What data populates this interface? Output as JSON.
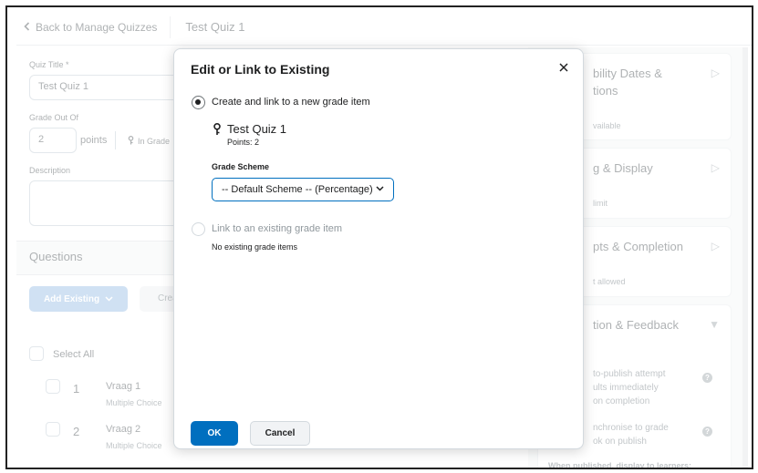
{
  "topbar": {
    "back_label": "Back to Manage Quizzes",
    "title": "Test Quiz 1"
  },
  "form": {
    "quiz_title_label": "Quiz Title *",
    "quiz_title_value": "Test Quiz 1",
    "grade_out_of_label": "Grade Out Of",
    "grade_out_of_value": "2",
    "points_label": "points",
    "in_grade_label": "In Grade",
    "description_label": "Description"
  },
  "questions": {
    "title": "Questions",
    "add_existing_label": "Add Existing",
    "create_label": "Crea",
    "select_all_label": "Select All",
    "items": [
      {
        "number": "1",
        "name": "Vraag 1",
        "type": "Multiple Choice"
      },
      {
        "number": "2",
        "name": "Vraag 2",
        "type": "Multiple Choice"
      }
    ]
  },
  "right_panel": {
    "cards": [
      {
        "title_line1": "bility Dates &",
        "title_line2": "tions",
        "sub": "vailable"
      },
      {
        "title_line1": "g & Display",
        "sub": "limit"
      },
      {
        "title_line1": "pts & Completion",
        "sub": "t allowed"
      },
      {
        "title_line1": "tion & Feedback",
        "lines1": [
          "to-publish attempt",
          "ults immediately",
          "on completion"
        ],
        "lines2": [
          "nchronise to grade",
          "ok on publish"
        ],
        "footer": "When published, display to learners:"
      }
    ]
  },
  "dialog": {
    "title": "Edit or Link to Existing",
    "option_new_label": "Create and link to a new grade item",
    "grade_item_name": "Test Quiz 1",
    "grade_item_points": "Points: 2",
    "grade_scheme_label": "Grade Scheme",
    "grade_scheme_value": "-- Default Scheme -- (Percentage)",
    "option_existing_label": "Link to an existing grade item",
    "no_existing_text": "No existing grade items",
    "ok_label": "OK",
    "cancel_label": "Cancel"
  }
}
